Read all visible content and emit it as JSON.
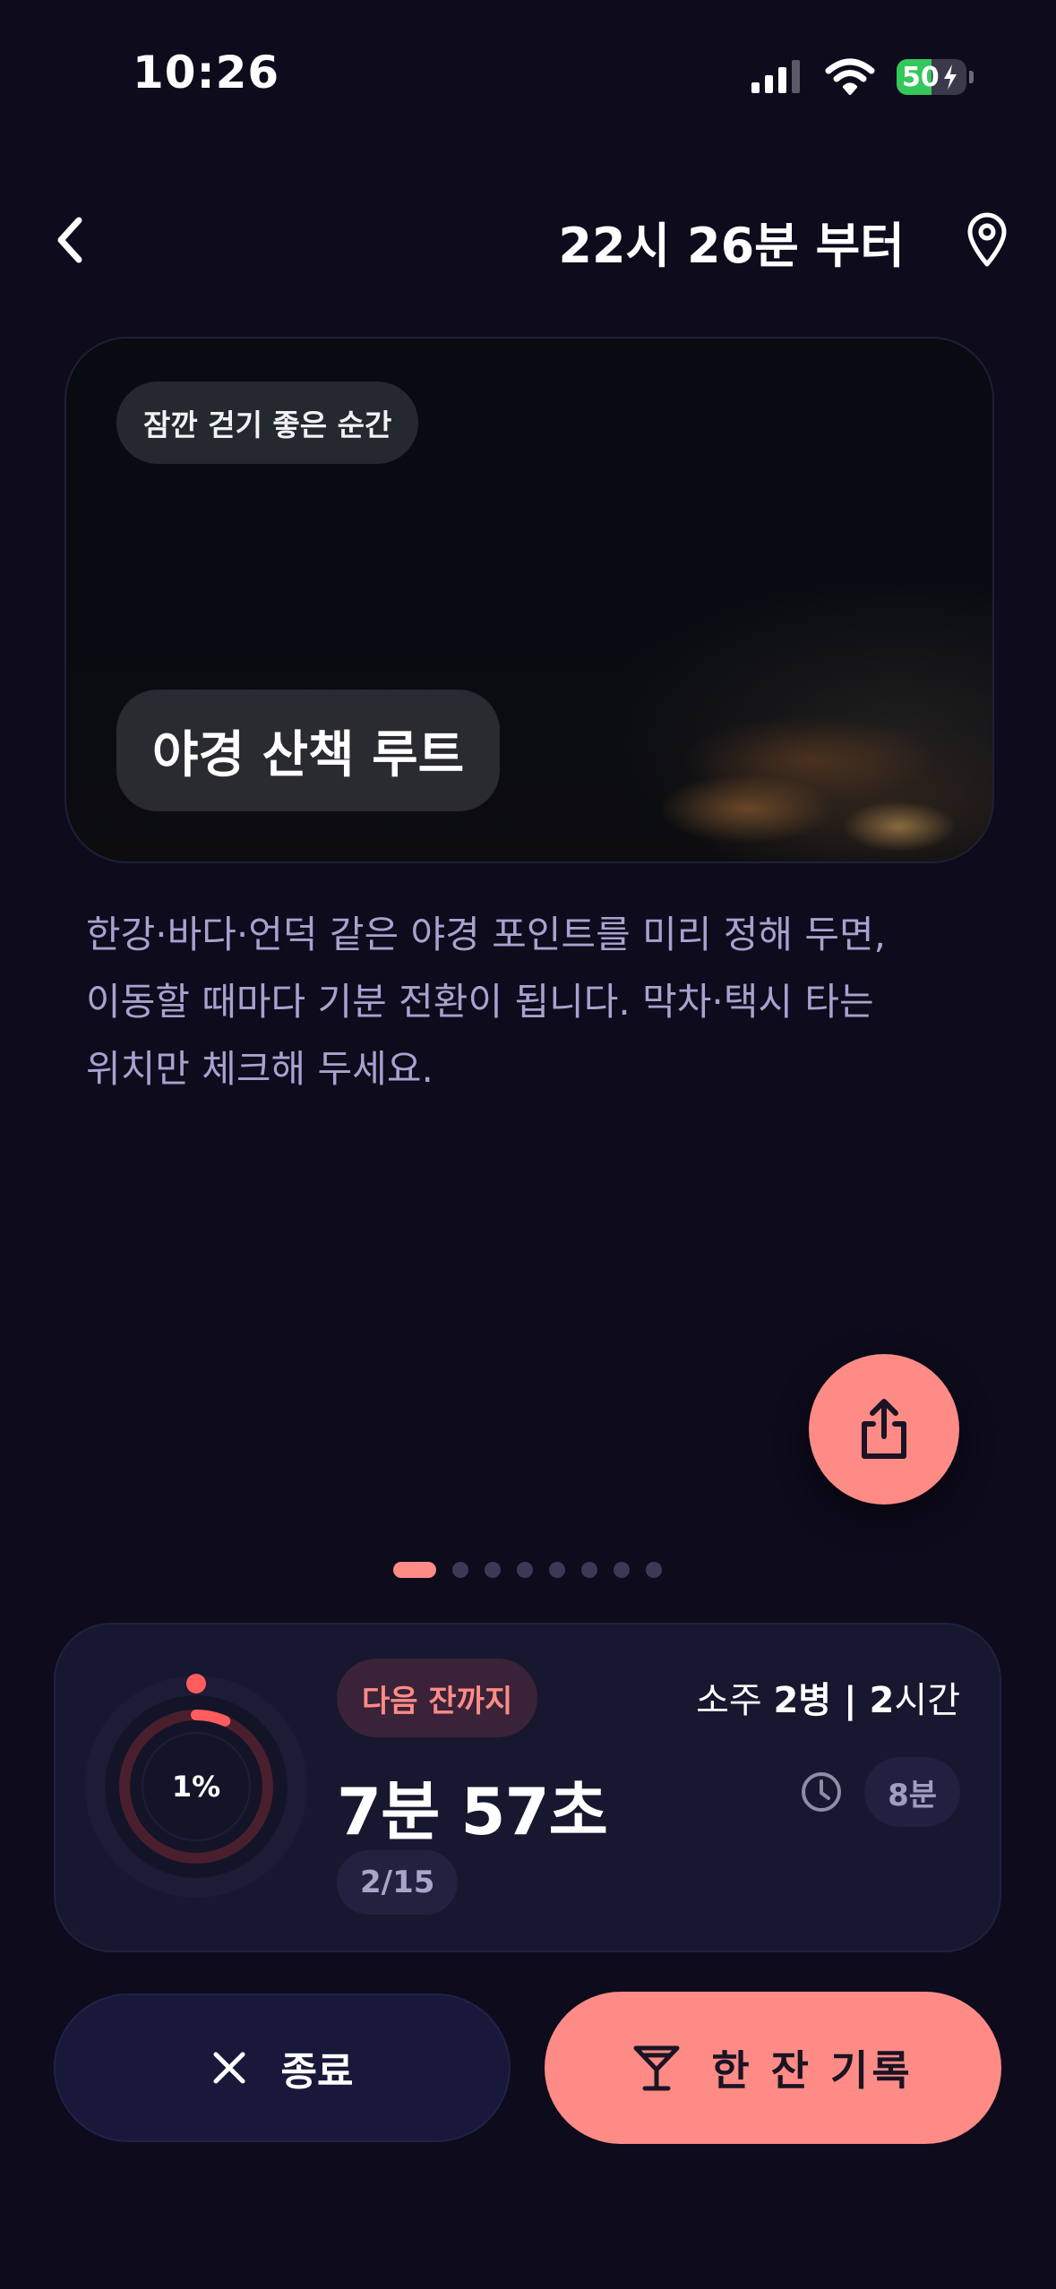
{
  "status_bar": {
    "time": "10:26",
    "battery_text": "50",
    "battery_level": 0.5
  },
  "header": {
    "title": "22시 26분 부터",
    "back_icon": "chevron-left-icon",
    "location_icon": "map-pin-icon"
  },
  "hero": {
    "chip_label": "잠깐 걷기 좋은 순간",
    "title": "야경 산책 루트"
  },
  "description": "한강·바다·언덕 같은 야경 포인트를 미리 정해 두면,\n이동할 때마다 기분 전환이 됩니다. 막차·택시 타는\n위치만 체크해 두세요.",
  "share_icon": "share-icon",
  "pagination": {
    "total": 8,
    "active_index": 0
  },
  "progress": {
    "percent_label": "1%",
    "percent_value": 0.01,
    "next_label": "다음 잔까지",
    "timer": "7분 57초",
    "count": "2/15",
    "plan": {
      "drink_prefix": "소주 ",
      "drink_amount": "2병",
      "separator": " | ",
      "duration_amount": "2",
      "duration_unit": "시간"
    },
    "interval_icon": "clock-icon",
    "interval": "8분"
  },
  "actions": {
    "end_label": "종료",
    "end_icon": "close-icon",
    "record_label": "한 잔 기록",
    "record_icon": "cocktail-glass-icon"
  },
  "colors": {
    "background": "#0d0b1c",
    "accent": "#ff8b86",
    "card": "#17172f",
    "description_text": "#aaa1cf",
    "battery_green": "#34c759"
  }
}
